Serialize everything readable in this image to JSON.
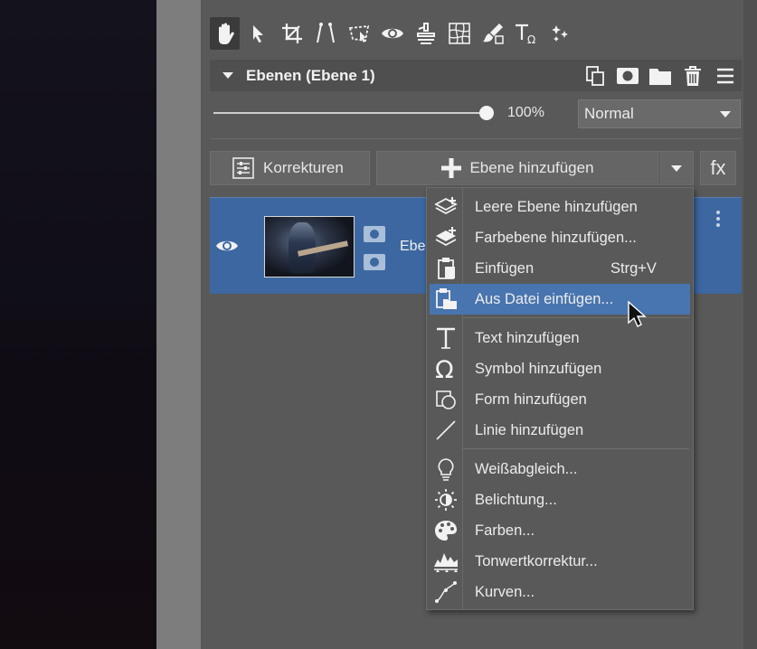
{
  "toolbar": {
    "tools": [
      {
        "name": "hand-tool",
        "icon": "hand-icon",
        "active": true
      },
      {
        "name": "select-tool",
        "icon": "arrow-icon"
      },
      {
        "name": "crop-tool",
        "icon": "crop-icon"
      },
      {
        "name": "straighten-tool",
        "icon": "straighten-icon"
      },
      {
        "name": "transform-tool",
        "icon": "transform-icon"
      },
      {
        "name": "redeye-tool",
        "icon": "eye-icon"
      },
      {
        "name": "clone-tool",
        "icon": "stamp-icon"
      },
      {
        "name": "perspective-tool",
        "icon": "grid-warp-icon"
      },
      {
        "name": "brush-tool",
        "icon": "brush-icon"
      },
      {
        "name": "text-tool",
        "icon": "text-symbol-icon"
      },
      {
        "name": "effects-tool",
        "icon": "stars-icon"
      }
    ]
  },
  "layers_panel": {
    "title": "Ebenen (Ebene 1)",
    "opacity_value": 1.0,
    "opacity_label": "100%",
    "blend_mode": "Normal",
    "corrections_button": "Korrekturen",
    "add_layer_button": "Ebene hinzufügen",
    "fx_button": "fx",
    "layer": {
      "name": "Ebe",
      "visible": true
    }
  },
  "context_menu": {
    "items": [
      {
        "label": "Leere Ebene hinzufügen",
        "icon": "layers-add-icon"
      },
      {
        "label": "Farbebene hinzufügen...",
        "icon": "color-layer-add-icon"
      },
      {
        "label": "Einfügen",
        "icon": "paste-icon",
        "shortcut": "Strg+V"
      },
      {
        "label": "Aus Datei einfügen...",
        "icon": "paste-from-file-icon",
        "highlighted": true
      },
      {
        "label": "Text hinzufügen",
        "icon": "text-icon"
      },
      {
        "label": "Symbol hinzufügen",
        "icon": "omega-icon"
      },
      {
        "label": "Form hinzufügen",
        "icon": "shape-icon"
      },
      {
        "label": "Linie hinzufügen",
        "icon": "line-icon"
      },
      {
        "label": "Weißabgleich...",
        "icon": "bulb-icon"
      },
      {
        "label": "Belichtung...",
        "icon": "exposure-icon"
      },
      {
        "label": "Farben...",
        "icon": "palette-icon"
      },
      {
        "label": "Tonwertkorrektur...",
        "icon": "levels-icon"
      },
      {
        "label": "Kurven...",
        "icon": "curves-icon"
      }
    ]
  },
  "colors": {
    "panel_bg": "#595959",
    "selected_layer": "#3d67a1",
    "menu_highlight": "#4875af"
  }
}
